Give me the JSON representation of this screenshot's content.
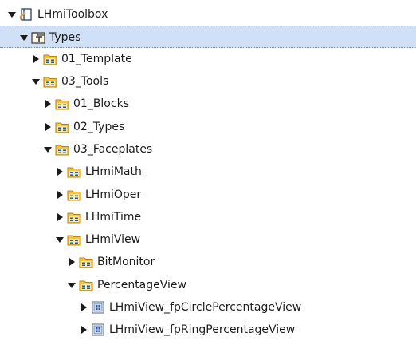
{
  "tree": {
    "items": [
      {
        "label": "LHmiToolbox",
        "icon": "library-icon",
        "state": "expanded",
        "depth": 0,
        "selected": false
      },
      {
        "label": "Types",
        "icon": "types-folder-icon",
        "state": "expanded",
        "depth": 1,
        "selected": true
      },
      {
        "label": "01_Template",
        "icon": "folder-icon",
        "state": "collapsed",
        "depth": 2,
        "selected": false
      },
      {
        "label": "03_Tools",
        "icon": "folder-icon",
        "state": "expanded",
        "depth": 2,
        "selected": false
      },
      {
        "label": "01_Blocks",
        "icon": "folder-icon",
        "state": "collapsed",
        "depth": 3,
        "selected": false
      },
      {
        "label": "02_Types",
        "icon": "folder-icon",
        "state": "collapsed",
        "depth": 3,
        "selected": false
      },
      {
        "label": "03_Faceplates",
        "icon": "folder-icon",
        "state": "expanded",
        "depth": 3,
        "selected": false
      },
      {
        "label": "LHmiMath",
        "icon": "folder-icon",
        "state": "collapsed",
        "depth": 4,
        "selected": false
      },
      {
        "label": "LHmiOper",
        "icon": "folder-icon",
        "state": "collapsed",
        "depth": 4,
        "selected": false
      },
      {
        "label": "LHmiTime",
        "icon": "folder-icon",
        "state": "collapsed",
        "depth": 4,
        "selected": false
      },
      {
        "label": "LHmiView",
        "icon": "folder-icon",
        "state": "expanded",
        "depth": 4,
        "selected": false
      },
      {
        "label": "BitMonitor",
        "icon": "folder-icon",
        "state": "collapsed",
        "depth": 5,
        "selected": false
      },
      {
        "label": "PercentageView",
        "icon": "folder-icon",
        "state": "expanded",
        "depth": 5,
        "selected": false
      },
      {
        "label": "LHmiView_fpCirclePercentageView",
        "icon": "faceplate-type-icon",
        "state": "collapsed",
        "depth": 6,
        "selected": false
      },
      {
        "label": "LHmiView_fpRingPercentageView",
        "icon": "faceplate-type-icon",
        "state": "collapsed",
        "depth": 6,
        "selected": false
      }
    ]
  }
}
